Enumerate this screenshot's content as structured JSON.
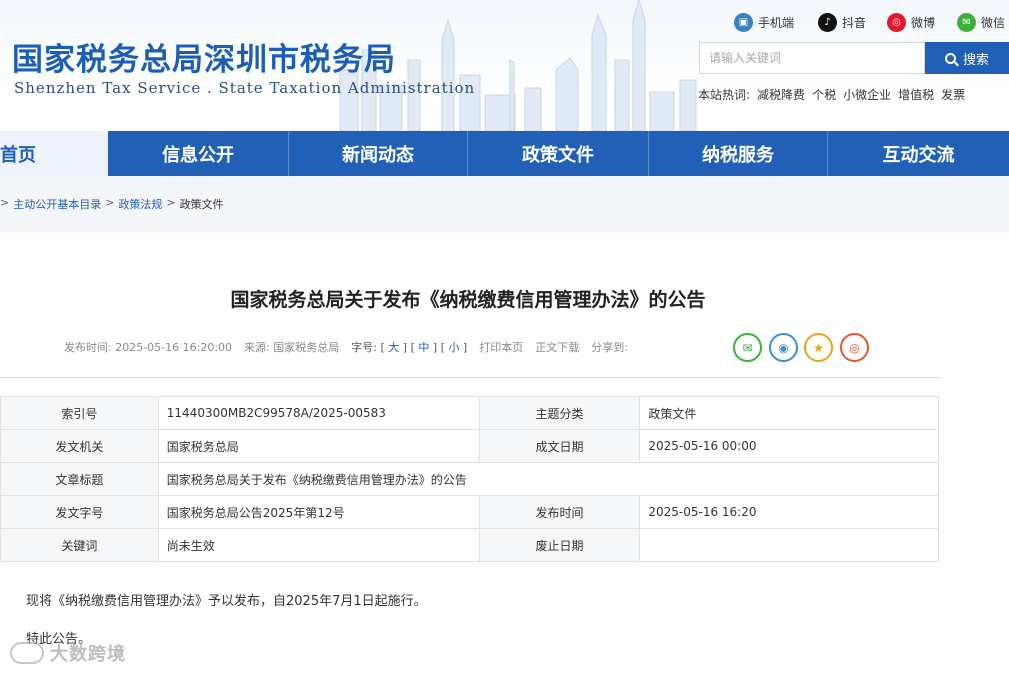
{
  "header": {
    "site_title": "国家税务总局深圳市税务局",
    "site_subtitle": "Shenzhen Tax Service . State Taxation Administration",
    "social": [
      {
        "label": "手机端",
        "icon": "mobile-icon",
        "color": "#3b7fc4"
      },
      {
        "label": "抖音",
        "icon": "douyin-icon",
        "color": "#111111"
      },
      {
        "label": "微博",
        "icon": "weibo-icon",
        "color": "#e6162d"
      },
      {
        "label": "微信",
        "icon": "wechat-icon",
        "color": "#3bb03b"
      }
    ],
    "search": {
      "placeholder": "请输入关键词",
      "button_label": "搜索"
    },
    "hot_label": "本站热词:",
    "hot_keywords": [
      "减税降费",
      "个税",
      "小微企业",
      "增值税",
      "发票"
    ]
  },
  "nav": {
    "items": [
      "首页",
      "信息公开",
      "新闻动态",
      "政策文件",
      "纳税服务",
      "互动交流"
    ],
    "active_index": 0
  },
  "breadcrumb": [
    "主动公开基本目录",
    "政策法规",
    "政策文件"
  ],
  "article": {
    "title": "国家税务总局关于发布《纳税缴费信用管理办法》的公告",
    "meta": {
      "publish_label": "发布时间:",
      "publish_time": "2025-05-16 16:20:00",
      "source_label": "来源:",
      "source": "国家税务总局",
      "font_label": "字号:",
      "font_large": "大",
      "font_medium": "中",
      "font_small": "小",
      "print": "打印本页",
      "download": "正文下载",
      "share_label": "分享到:"
    },
    "share_icons": [
      {
        "name": "wechat-share-icon",
        "color": "#3bb03b",
        "glyph": "✉"
      },
      {
        "name": "qq-share-icon",
        "color": "#3b8fd6",
        "glyph": "◉"
      },
      {
        "name": "qzone-share-icon",
        "color": "#e8a317",
        "glyph": "★"
      },
      {
        "name": "weibo-share-icon",
        "color": "#e05a2b",
        "glyph": "◎"
      }
    ],
    "info": {
      "index_no_label": "索引号",
      "index_no": "11440300MB2C99578A/2025-00583",
      "topic_label": "主题分类",
      "topic": "政策文件",
      "issuer_label": "发文机关",
      "issuer": "国家税务总局",
      "created_label": "成文日期",
      "created": "2025-05-16 00:00",
      "doc_title_label": "文章标题",
      "doc_title": "国家税务总局关于发布《纳税缴费信用管理办法》的公告",
      "doc_no_label": "发文字号",
      "doc_no": "国家税务总局公告2025年第12号",
      "pub_label": "发布时间",
      "pub": "2025-05-16 16:20",
      "keywords_label": "关键词",
      "keywords": "尚未生效",
      "expiry_label": "废止日期",
      "expiry": ""
    },
    "body": [
      "现将《纳税缴费信用管理办法》予以发布，自2025年7月1日起施行。",
      "特此公告。"
    ]
  },
  "watermark": "大数跨境"
}
